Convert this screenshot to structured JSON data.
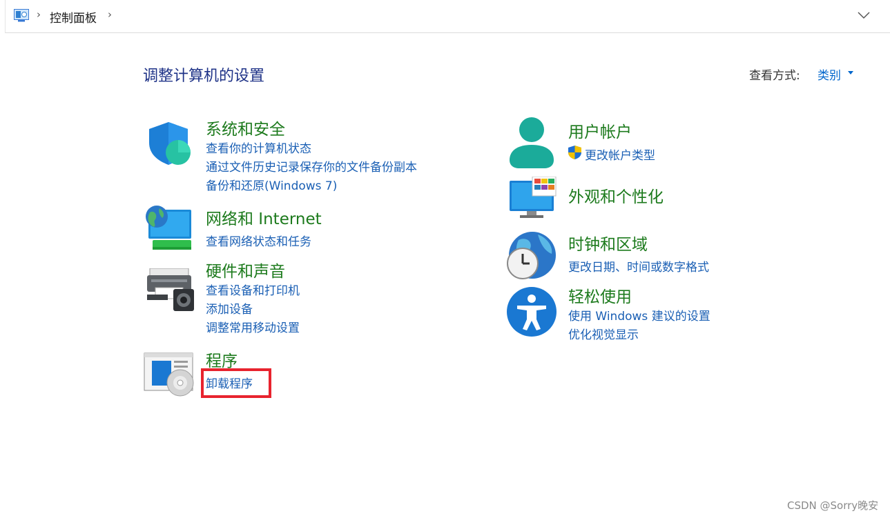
{
  "address_bar": {
    "breadcrumb": "控制面板",
    "icons": [
      "control-panel-icon",
      "chevron-right-icon",
      "chevron-down-icon"
    ]
  },
  "header": {
    "title": "调整计算机的设置",
    "view_by_label": "查看方式:",
    "view_by_value": "类别"
  },
  "categories": {
    "system_security": {
      "title": "系统和安全",
      "icon": "shield-icon",
      "links": [
        "查看你的计算机状态",
        "通过文件历史记录保存你的文件备份副本",
        "备份和还原(Windows 7)"
      ]
    },
    "network": {
      "title": "网络和 Internet",
      "icon": "network-globe-icon",
      "links": [
        "查看网络状态和任务"
      ]
    },
    "hardware": {
      "title": "硬件和声音",
      "icon": "printer-speaker-icon",
      "links": [
        "查看设备和打印机",
        "添加设备",
        "调整常用移动设置"
      ]
    },
    "programs": {
      "title": "程序",
      "icon": "programs-disc-icon",
      "links": [
        "卸载程序"
      ]
    },
    "user_accounts": {
      "title": "用户帐户",
      "icon": "user-icon",
      "links": [
        "更改帐户类型"
      ]
    },
    "appearance": {
      "title": "外观和个性化",
      "icon": "monitor-personalize-icon",
      "links": []
    },
    "clock_region": {
      "title": "时钟和区域",
      "icon": "clock-globe-icon",
      "links": [
        "更改日期、时间或数字格式"
      ]
    },
    "ease_of_access": {
      "title": "轻松使用",
      "icon": "accessibility-icon",
      "links": [
        "使用 Windows 建议的设置",
        "优化视觉显示"
      ]
    }
  },
  "annotation": {
    "color": "#e8232e"
  },
  "watermark": "CSDN @Sorry晚安",
  "colors": {
    "category_title": "#1c7a1c",
    "link": "#1a5fb4",
    "page_title": "#1e3287"
  }
}
